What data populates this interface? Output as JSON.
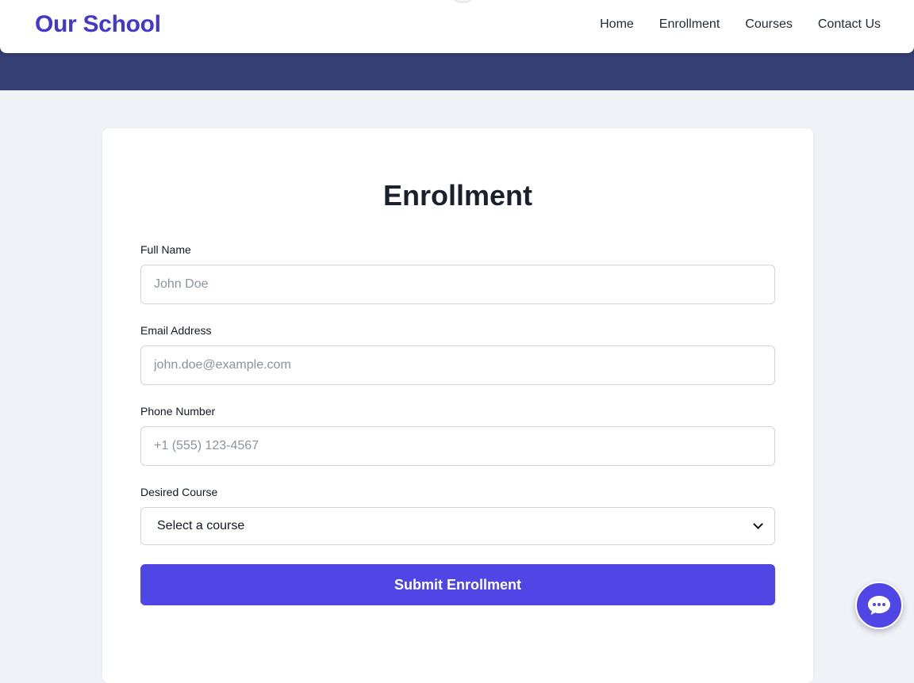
{
  "header": {
    "brand": "Our School",
    "nav": [
      {
        "label": "Home"
      },
      {
        "label": "Enrollment"
      },
      {
        "label": "Courses"
      },
      {
        "label": "Contact Us"
      }
    ]
  },
  "form": {
    "title": "Enrollment",
    "full_name": {
      "label": "Full Name",
      "placeholder": "John Doe",
      "value": ""
    },
    "email": {
      "label": "Email Address",
      "placeholder": "john.doe@example.com",
      "value": ""
    },
    "phone": {
      "label": "Phone Number",
      "placeholder": "+1 (555) 123-4567",
      "value": ""
    },
    "course": {
      "label": "Desired Course",
      "selected": "Select a course"
    },
    "submit_label": "Submit Enrollment"
  },
  "chat": {
    "icon": "chat-bubble-icon"
  },
  "colors": {
    "brand": "#4338ca",
    "accent": "#4f46e5",
    "hero_band": "#343f73",
    "page_bg": "#eff2f7"
  }
}
